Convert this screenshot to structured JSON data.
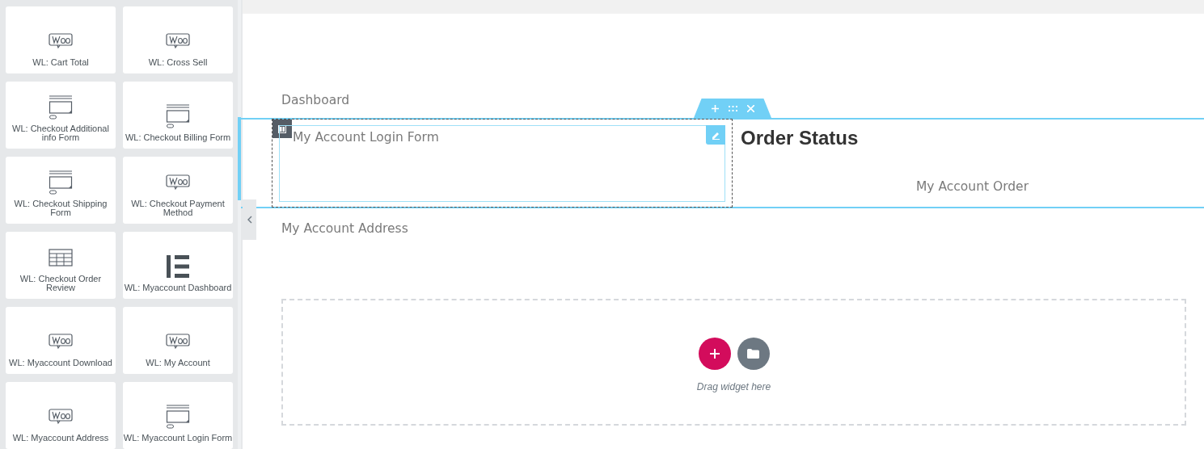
{
  "widgets": [
    {
      "label": "WL: Cart Total",
      "kind": "woo"
    },
    {
      "label": "WL: Cross Sell",
      "kind": "woo"
    },
    {
      "label": "WL: Checkout Additional info Form",
      "kind": "form"
    },
    {
      "label": "WL: Checkout Billing Form",
      "kind": "form"
    },
    {
      "label": "WL: Checkout Shipping Form",
      "kind": "form"
    },
    {
      "label": "WL: Checkout Payment Method",
      "kind": "woo"
    },
    {
      "label": "WL: Checkout Order Review",
      "kind": "table"
    },
    {
      "label": "WL: Myaccount Dashboard",
      "kind": "elementor"
    },
    {
      "label": "WL: Myaccount Download",
      "kind": "woo"
    },
    {
      "label": "WL: My Account",
      "kind": "woo"
    },
    {
      "label": "WL: Myaccount Address",
      "kind": "woo"
    },
    {
      "label": "WL: Myaccount Login Form",
      "kind": "form"
    }
  ],
  "canvas": {
    "dashboard": "Dashboard",
    "login_widget": "My Account Login Form",
    "order_heading": "Order Status",
    "order_text": "My Account Order",
    "address": "My Account Address",
    "dropzone_hint": "Drag widget here"
  }
}
